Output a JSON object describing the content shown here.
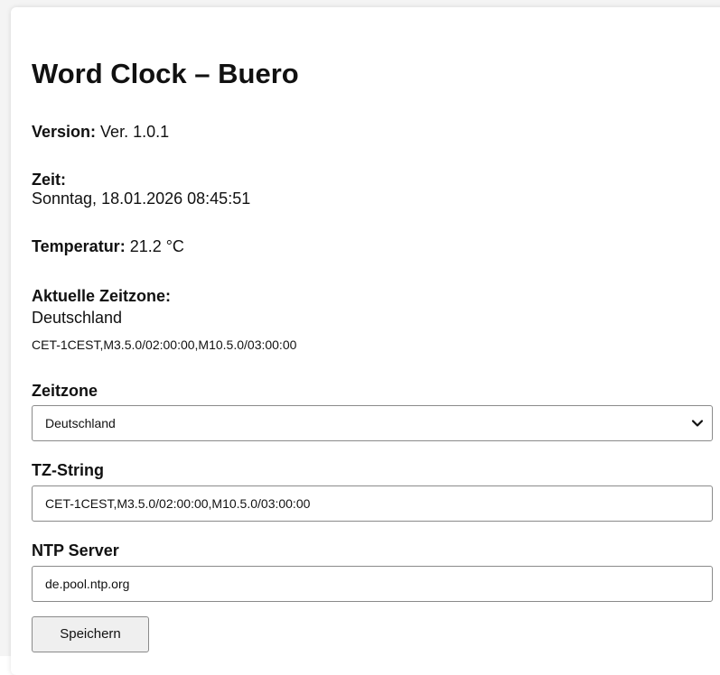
{
  "header": {
    "title": "Word Clock – Buero"
  },
  "info": {
    "version_label": "Version:",
    "version_value": "Ver. 1.0.1",
    "time_label": "Zeit:",
    "time_value": "Sonntag, 18.01.2026 08:45:51",
    "temperature_label": "Temperatur:",
    "temperature_value": "21.2 °C",
    "current_timezone_label": "Aktuelle Zeitzone:",
    "current_timezone_name": "Deutschland",
    "current_timezone_tz": "CET-1CEST,M3.5.0/02:00:00,M10.5.0/03:00:00"
  },
  "form": {
    "timezone_label": "Zeitzone",
    "timezone_selected": "Deutschland",
    "tz_string_label": "TZ-String",
    "tz_string_value": "CET-1CEST,M3.5.0/02:00:00,M10.5.0/03:00:00",
    "ntp_label": "NTP Server",
    "ntp_value": "de.pool.ntp.org",
    "save_label": "Speichern"
  },
  "icons": {
    "select_arrow": "chevron-down-icon"
  }
}
